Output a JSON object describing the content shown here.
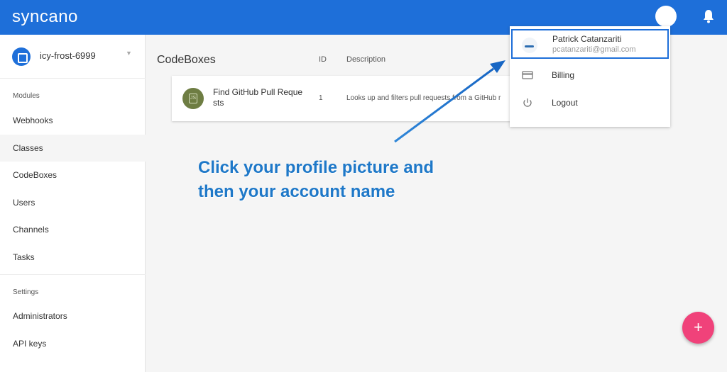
{
  "header": {
    "logo": "syncano",
    "colors": {
      "accent": "#1e6fd9",
      "fab": "#f0427a"
    }
  },
  "sidebar": {
    "instance_name": "icy-frost-6999",
    "modules_heading": "Modules",
    "modules": [
      {
        "label": "Webhooks"
      },
      {
        "label": "Classes"
      },
      {
        "label": "CodeBoxes"
      },
      {
        "label": "Users"
      },
      {
        "label": "Channels"
      },
      {
        "label": "Tasks"
      }
    ],
    "settings_heading": "Settings",
    "settings": [
      {
        "label": "Administrators"
      },
      {
        "label": "API keys"
      }
    ]
  },
  "main": {
    "title": "CodeBoxes",
    "columns": {
      "id": "ID",
      "description": "Description"
    },
    "rows": [
      {
        "name": "Find GitHub Pull Requests",
        "name_line1": "Find GitHub Pull Reque",
        "name_line2": "sts",
        "id": "1",
        "description": "Looks up and filters pull requests from a GitHub r"
      }
    ]
  },
  "account_menu": {
    "name": "Patrick Catanzariti",
    "email": "pcatanzariti@gmail.com",
    "items": [
      {
        "label": "Billing",
        "icon": "credit-card-icon"
      },
      {
        "label": "Logout",
        "icon": "power-icon"
      }
    ]
  },
  "annotation": {
    "line1": "Click your profile picture and",
    "line2": "then your account name"
  },
  "fab": {
    "label": "+"
  }
}
